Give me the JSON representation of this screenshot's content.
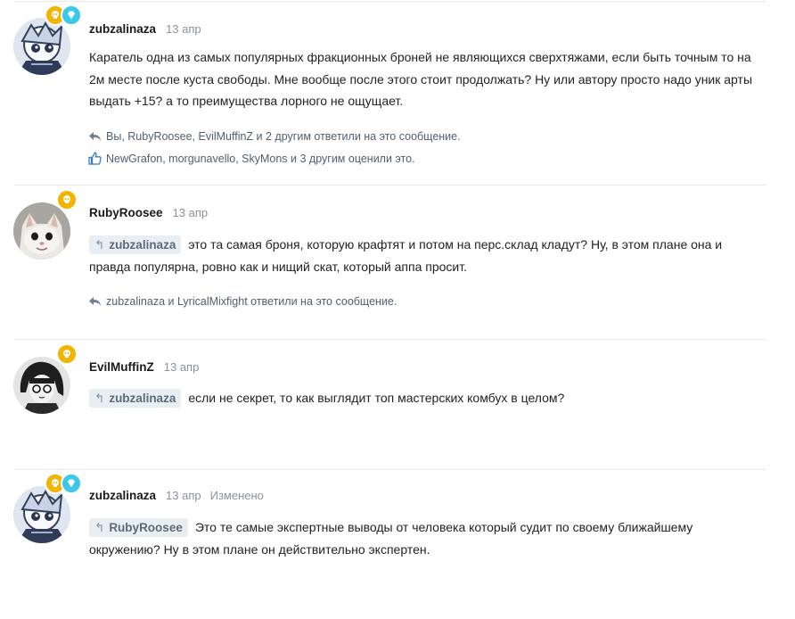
{
  "comments": [
    {
      "author": "zubzalinaza",
      "date": "13 апр",
      "text": "Каратель одна из самых популярных фракционных броней не являющихся сверхтяжами, если быть точным то на 2м месте после куста свободы. Мне вообще после этого стоит продолжать? Ну или автору просто надо уник арты выдать +15? а то преимущества лорного не ощущает.",
      "replies_text": "Вы, RubyRoosee, EvilMuffinZ и 2 другим ответили на это сообщение.",
      "likes_text": "NewGrafon, morgunavello, SkyMons и 3 другим оценили это."
    },
    {
      "author": "RubyRoosee",
      "date": "13 апр",
      "quote": "zubzalinaza",
      "text": "это та самая броня, которую крафтят и потом на перс.склад кладут? Ну, в этом плане она и правда популярна, ровно как и нищий скат, который аппа просит.",
      "replies_text": "zubzalinaza и LyricalMixfight ответили на это сообщение."
    },
    {
      "author": "EvilMuffinZ",
      "date": "13 апр",
      "quote": "zubzalinaza",
      "text": "если не секрет, то как выглядит топ мастерских комбух в целом?"
    },
    {
      "author": "zubzalinaza",
      "date": "13 апр",
      "edited": "Изменено",
      "quote": "RubyRoosee",
      "text": "Это те самые экспертные выводы от человека который судит по своему ближайшему окружению? Ну в этом плане он действительно экспертен."
    }
  ],
  "colors": {
    "accent_quote_bg": "#e9eef3",
    "badge_gold": "#f3b400",
    "badge_diamond": "#3cc8e8"
  }
}
